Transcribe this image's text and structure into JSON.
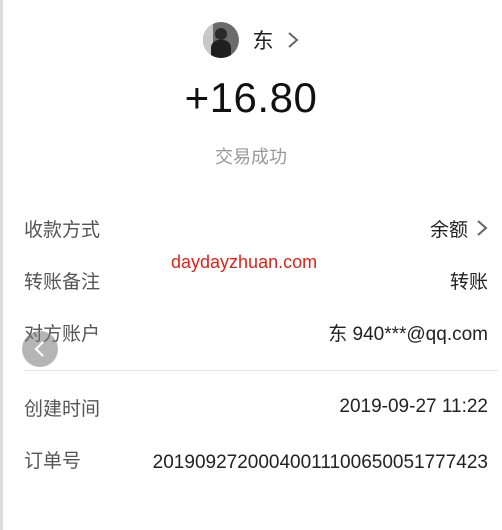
{
  "header": {
    "user_name": "东",
    "amount": "+16.80",
    "status": "交易成功"
  },
  "details": {
    "payment_method_label": "收款方式",
    "payment_method_value": "余额",
    "note_label": "转账备注",
    "note_value": "转账",
    "counterparty_label": "对方账户",
    "counterparty_value": "东 940***@qq.com",
    "created_label": "创建时间",
    "created_value": "2019-09-27 11:22",
    "order_label": "订单号",
    "order_value": "20190927200040011100650051777423"
  },
  "watermark": "daydayzhuan.com",
  "colors": {
    "watermark": "#d9241b",
    "label": "#555555",
    "status": "#999999"
  },
  "icons": {
    "chevron": "chevron-right-icon",
    "back": "chevron-left-icon",
    "avatar": "avatar"
  }
}
